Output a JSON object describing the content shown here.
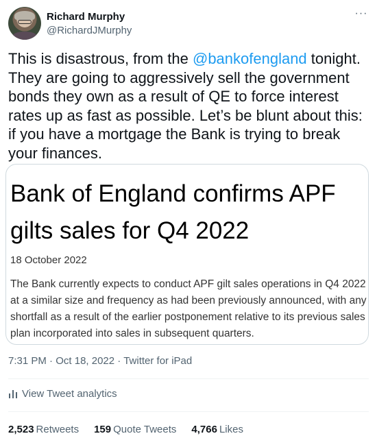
{
  "user": {
    "name": "Richard Murphy",
    "handle": "@RichardJMurphy"
  },
  "more_label": "···",
  "tweet": {
    "text_before": "This is disastrous, from the ",
    "mention": "@bankofengland",
    "text_after": " tonight. They are going to aggressively sell the government bonds they own as a result of QE to force interest rates up as fast as possible. Let’s be blunt about this: if you have a mortgage the Bank is trying to break your finances."
  },
  "card": {
    "title": "Bank of England confirms APF gilts sales for Q4 2022",
    "date": "18 October 2022",
    "body": "The Bank currently expects to conduct APF gilt sales operations in Q4 2022 at a similar size and frequency as had been previously announced, with any shortfall as a result of the earlier postponement relative to its previous sales plan incorporated into sales in subsequent quarters."
  },
  "meta": {
    "time": "7:31 PM",
    "separator1": " · ",
    "date": "Oct 18, 2022",
    "separator2": " · ",
    "source": "Twitter for iPad"
  },
  "analytics_label": "View Tweet analytics",
  "stats": {
    "retweets_count": "2,523",
    "retweets_label": "Retweets",
    "quotes_count": "159",
    "quotes_label": "Quote Tweets",
    "likes_count": "4,766",
    "likes_label": "Likes"
  },
  "colors": {
    "accent": "#1d9bf0",
    "text": "#0f1419",
    "secondary": "#536471",
    "border": "#cfd9de"
  }
}
